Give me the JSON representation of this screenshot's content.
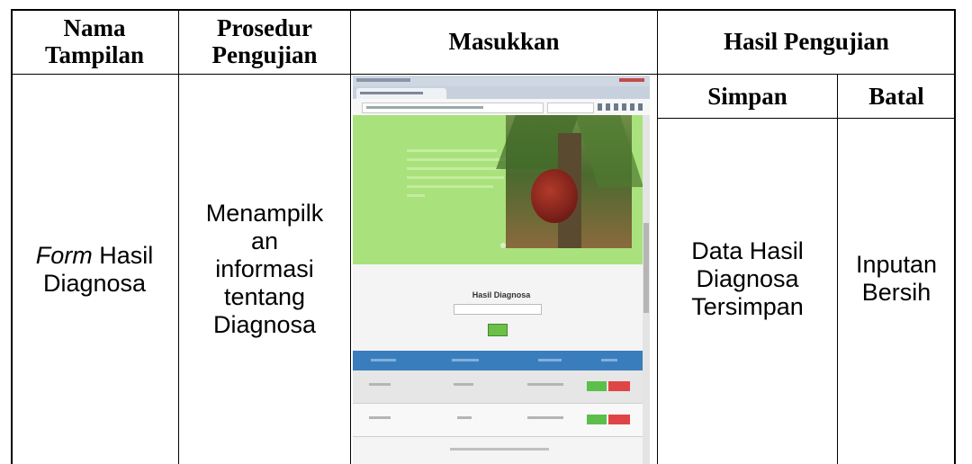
{
  "header": {
    "col1_line1": "Nama",
    "col1_line2": "Tampilan",
    "col2_line1": "Prosedur",
    "col2_line2": "Pengujian",
    "col3": "Masukkan",
    "col4": "Hasil Pengujian",
    "sub_simpan": "Simpan",
    "sub_batal": "Batal"
  },
  "row": {
    "nama_italic": "Form",
    "nama_rest": " Hasil",
    "nama_line2": "Diagnosa",
    "prosedur": [
      "Menampilk",
      "an",
      "informasi",
      "tentang",
      "Diagnosa"
    ],
    "simpan": [
      "Data Hasil",
      "Diagnosa",
      "Tersimpan"
    ],
    "batal": [
      "Inputan",
      "Bersih"
    ]
  },
  "screenshot": {
    "form_title": "Hasil Diagnosa",
    "hero_color": "#a9e27c",
    "table_header_color": "#3a7dbd"
  }
}
